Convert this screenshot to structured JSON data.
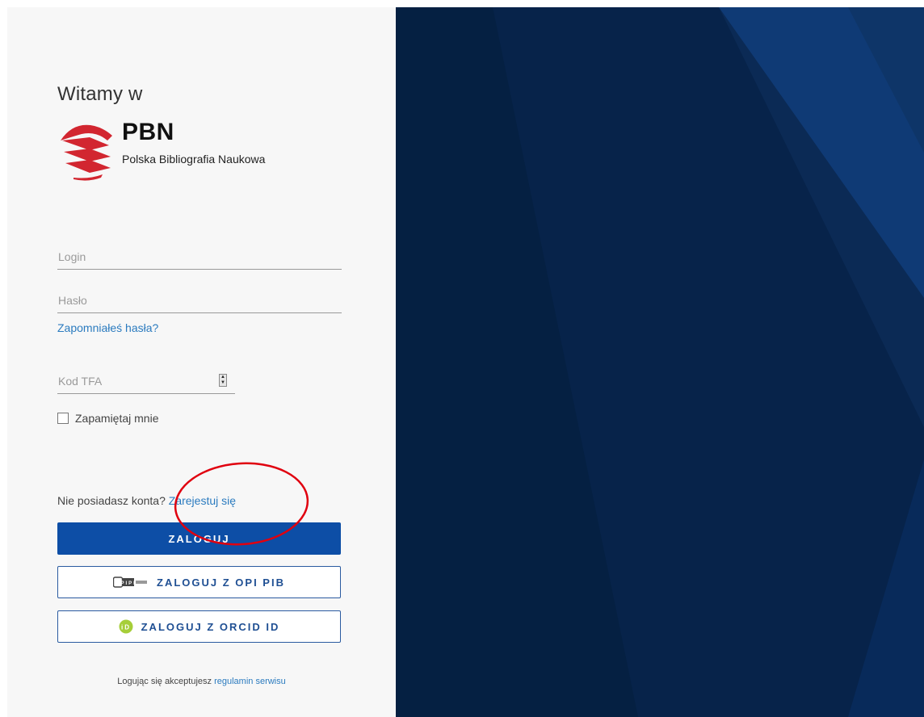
{
  "welcome_text": "Witamy w",
  "logo": {
    "title": "PBN",
    "subtitle": "Polska Bibliografia Naukowa"
  },
  "form": {
    "login_placeholder": "Login",
    "password_placeholder": "Hasło",
    "forgot_password": "Zapomniałeś hasła?",
    "tfa_placeholder": "Kod TFA",
    "remember_me": "Zapamiętaj mnie"
  },
  "register": {
    "prompt": "Nie posiadasz konta?",
    "link": "Zarejestuj się"
  },
  "buttons": {
    "login": "ZALOGUJ",
    "opi_badge": "OPIPIB",
    "opi": "ZALOGUJ Z OPI PIB",
    "orcid_badge": "iD",
    "orcid": "ZALOGUJ Z ORCID ID"
  },
  "footer": {
    "text": "Logując się akceptujesz",
    "link": "regulamin serwisu"
  },
  "colors": {
    "primary": "#0d4ea6",
    "link": "#2b7bbf",
    "logo_red": "#d22630",
    "background_dark": "#0a2a58",
    "annotation": "#e0000f"
  }
}
